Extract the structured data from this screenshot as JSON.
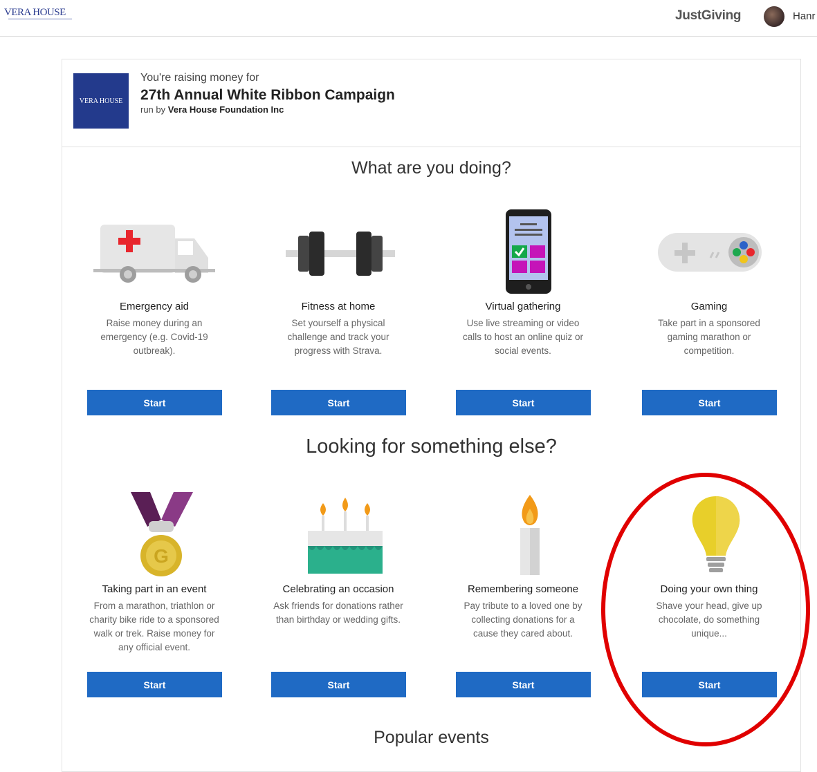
{
  "header": {
    "logo_text": "VERA HOUSE",
    "justgiving_label": "JustGiving",
    "username": "Hanr"
  },
  "campaign": {
    "thumb_text": "VERA HOUSE",
    "raising_label": "You're raising money for",
    "title": "27th Annual White Ribbon Campaign",
    "run_by_prefix": "run by",
    "run_by_org": "Vera House Foundation Inc"
  },
  "section1": {
    "heading": "What are you doing?",
    "cards": [
      {
        "title": "Emergency aid",
        "desc": "Raise money during an emergency (e.g. Covid-19 outbreak).",
        "button": "Start",
        "icon": "ambulance-icon"
      },
      {
        "title": "Fitness at home",
        "desc": "Set yourself a physical challenge and track your progress with Strava.",
        "button": "Start",
        "icon": "dumbbell-icon"
      },
      {
        "title": "Virtual gathering",
        "desc": "Use live streaming or video calls to host an online quiz or social events.",
        "button": "Start",
        "icon": "phone-icon"
      },
      {
        "title": "Gaming",
        "desc": "Take part in a sponsored gaming marathon or competition.",
        "button": "Start",
        "icon": "gamepad-icon"
      }
    ]
  },
  "section2": {
    "heading": "Looking for something else?",
    "cards": [
      {
        "title": "Taking part in an event",
        "desc": "From a marathon, triathlon or charity bike ride to a sponsored walk or trek. Raise money for any official event.",
        "button": "Start",
        "icon": "medal-icon"
      },
      {
        "title": "Celebrating an occasion",
        "desc": "Ask friends for donations rather than birthday or wedding gifts.",
        "button": "Start",
        "icon": "cake-icon"
      },
      {
        "title": "Remembering someone",
        "desc": "Pay tribute to a loved one by collecting donations for a cause they cared about.",
        "button": "Start",
        "icon": "candle-icon"
      },
      {
        "title": "Doing your own thing",
        "desc": "Shave your head, give up chocolate, do something unique...",
        "button": "Start",
        "icon": "lightbulb-icon"
      }
    ]
  },
  "section3": {
    "heading": "Popular events"
  },
  "colors": {
    "button": "#1f6ac4",
    "highlight_circle": "#e00000",
    "campaign_thumb": "#233a8c"
  }
}
